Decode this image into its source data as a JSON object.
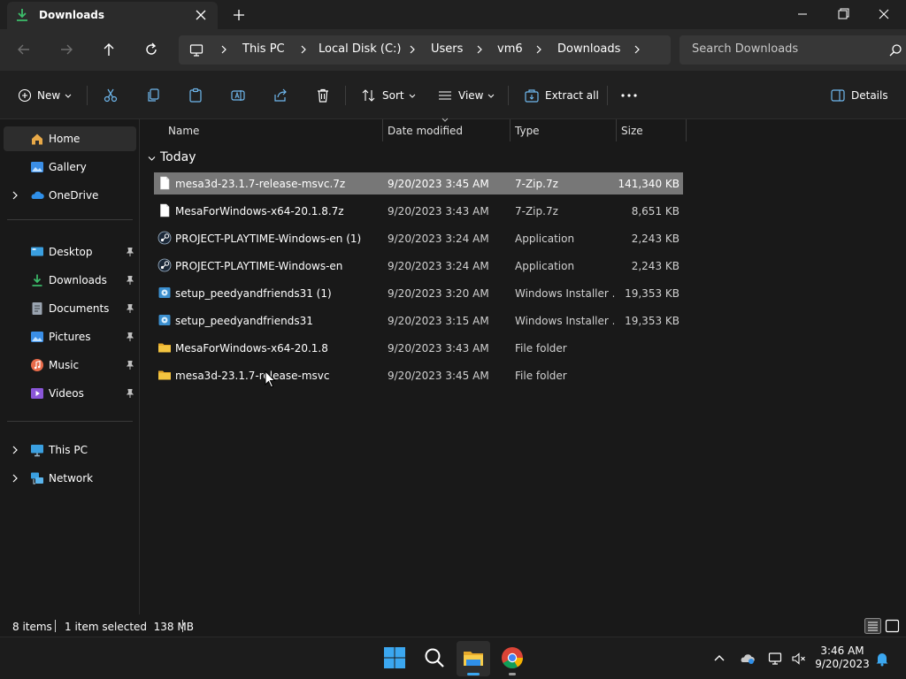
{
  "window": {
    "tab_title": "Downloads"
  },
  "address": {
    "crumbs": [
      "This PC",
      "Local Disk (C:)",
      "Users",
      "vm6",
      "Downloads"
    ],
    "search_placeholder": "Search Downloads"
  },
  "commands": {
    "new": "New",
    "sort": "Sort",
    "view": "View",
    "extract_all": "Extract all",
    "details": "Details"
  },
  "sidebar": {
    "items": [
      {
        "label": "Home",
        "icon": "home-icon",
        "color": "#e8a948"
      },
      {
        "label": "Gallery",
        "icon": "gallery-icon",
        "color": "#3a8ee6"
      },
      {
        "label": "OneDrive",
        "icon": "onedrive-icon",
        "color": "#2f8fe8"
      },
      {
        "label": "Desktop",
        "icon": "desktop-icon",
        "color": "#3a9fe0"
      },
      {
        "label": "Downloads",
        "icon": "download-icon",
        "color": "#3cbc6a"
      },
      {
        "label": "Documents",
        "icon": "documents-icon",
        "color": "#9aa4b0"
      },
      {
        "label": "Pictures",
        "icon": "pictures-icon",
        "color": "#3a8ee6"
      },
      {
        "label": "Music",
        "icon": "music-icon",
        "color": "#e86b4a"
      },
      {
        "label": "Videos",
        "icon": "videos-icon",
        "color": "#8a56d8"
      },
      {
        "label": "This PC",
        "icon": "computer-icon",
        "color": "#3a9fe0"
      },
      {
        "label": "Network",
        "icon": "network-icon",
        "color": "#3a9fe0"
      }
    ]
  },
  "columns": {
    "name": "Name",
    "date": "Date modified",
    "type": "Type",
    "size": "Size"
  },
  "group": {
    "label": "Today"
  },
  "files": [
    {
      "name": "mesa3d-23.1.7-release-msvc.7z",
      "date": "9/20/2023 3:45 AM",
      "type": "7-Zip.7z",
      "size": "141,340 KB",
      "icon": "file-icon"
    },
    {
      "name": "MesaForWindows-x64-20.1.8.7z",
      "date": "9/20/2023 3:43 AM",
      "type": "7-Zip.7z",
      "size": "8,651 KB",
      "icon": "file-icon"
    },
    {
      "name": "PROJECT-PLAYTIME-Windows-en (1)",
      "date": "9/20/2023 3:24 AM",
      "type": "Application",
      "size": "2,243 KB",
      "icon": "steam-icon"
    },
    {
      "name": "PROJECT-PLAYTIME-Windows-en",
      "date": "9/20/2023 3:24 AM",
      "type": "Application",
      "size": "2,243 KB",
      "icon": "steam-icon"
    },
    {
      "name": "setup_peedyandfriends31 (1)",
      "date": "9/20/2023 3:20 AM",
      "type": "Windows Installer ...",
      "size": "19,353 KB",
      "icon": "installer-icon"
    },
    {
      "name": "setup_peedyandfriends31",
      "date": "9/20/2023 3:15 AM",
      "type": "Windows Installer ...",
      "size": "19,353 KB",
      "icon": "installer-icon"
    },
    {
      "name": "MesaForWindows-x64-20.1.8",
      "date": "9/20/2023 3:43 AM",
      "type": "File folder",
      "size": "",
      "icon": "folder-icon"
    },
    {
      "name": "mesa3d-23.1.7-release-msvc",
      "date": "9/20/2023 3:45 AM",
      "type": "File folder",
      "size": "",
      "icon": "folder-icon"
    }
  ],
  "status": {
    "item_count": "8 items",
    "selection": "1 item selected  138 MB"
  },
  "clock": {
    "time": "3:46 AM",
    "date": "9/20/2023"
  },
  "colors": {
    "accent": "#3a9fe0",
    "folder": "#f3c440",
    "selection": "#777777"
  }
}
